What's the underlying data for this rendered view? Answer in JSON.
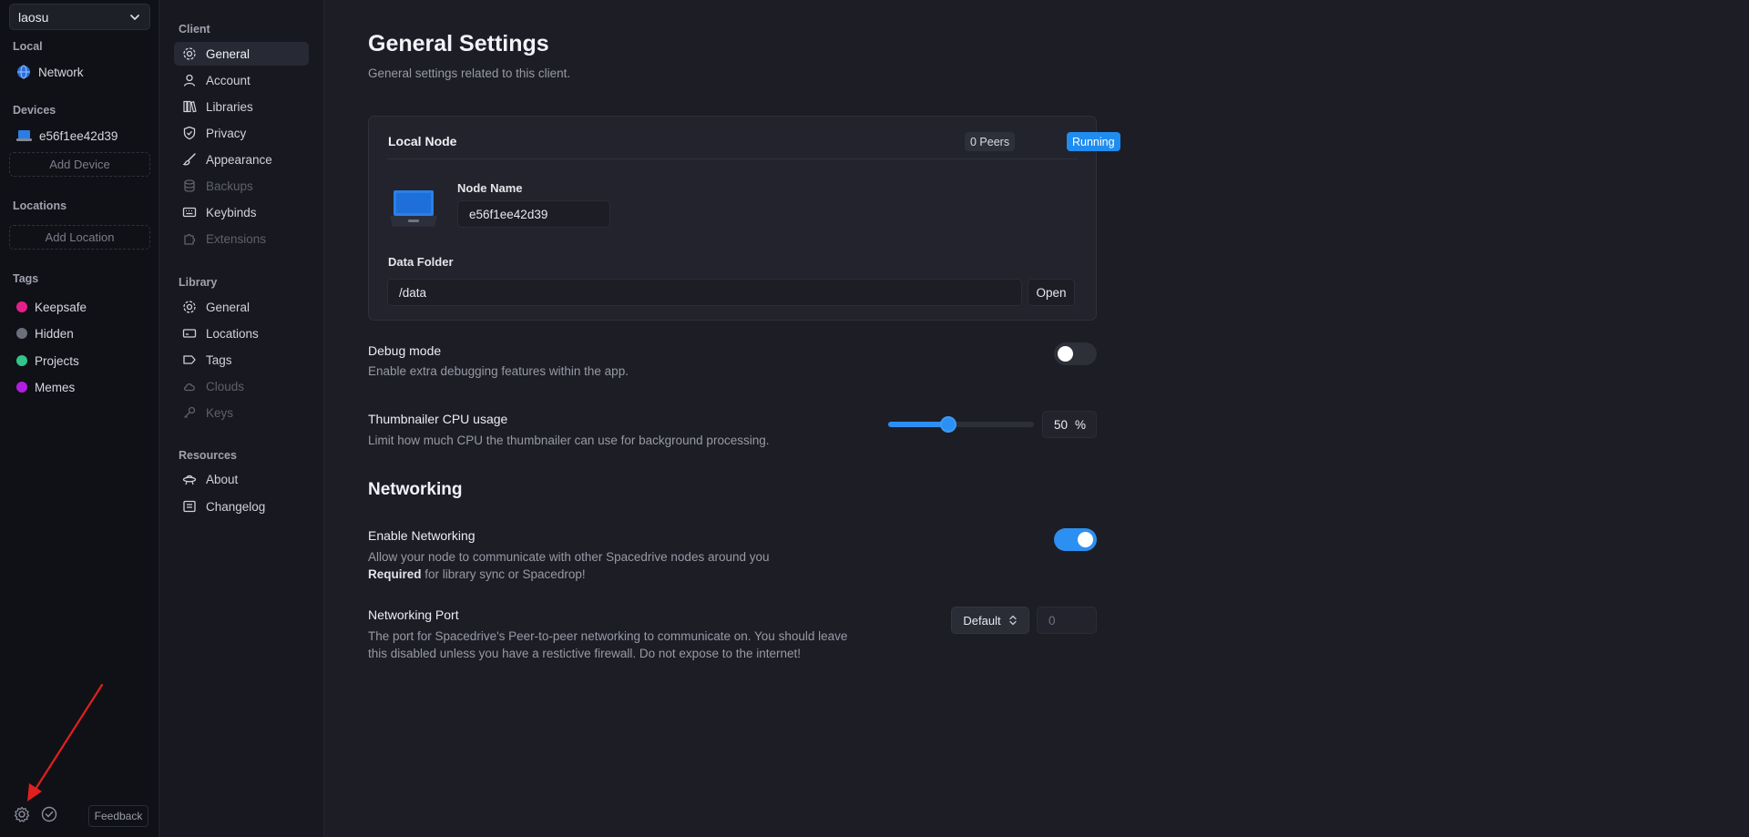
{
  "library_selector": {
    "value": "laosu"
  },
  "sidebar": {
    "local_heading": "Local",
    "local_items": [
      {
        "label": "Network",
        "icon": "globe-icon"
      }
    ],
    "devices_heading": "Devices",
    "devices": [
      {
        "label": "e56f1ee42d39",
        "icon": "laptop-icon"
      }
    ],
    "add_device": "Add Device",
    "locations_heading": "Locations",
    "add_location": "Add Location",
    "tags_heading": "Tags",
    "tags": [
      {
        "label": "Keepsafe",
        "color": "#e3208a"
      },
      {
        "label": "Hidden",
        "color": "#6b6f7c"
      },
      {
        "label": "Projects",
        "color": "#33c489"
      },
      {
        "label": "Memes",
        "color": "#b21ee0"
      }
    ],
    "feedback": "Feedback"
  },
  "settings_nav": {
    "client_heading": "Client",
    "client_items": [
      {
        "label": "General",
        "icon": "gear-icon",
        "active": true,
        "disabled": false
      },
      {
        "label": "Account",
        "icon": "user-icon",
        "active": false,
        "disabled": false
      },
      {
        "label": "Libraries",
        "icon": "books-icon",
        "active": false,
        "disabled": false
      },
      {
        "label": "Privacy",
        "icon": "shield-icon",
        "active": false,
        "disabled": false
      },
      {
        "label": "Appearance",
        "icon": "brush-icon",
        "active": false,
        "disabled": false
      },
      {
        "label": "Backups",
        "icon": "database-icon",
        "active": false,
        "disabled": true
      },
      {
        "label": "Keybinds",
        "icon": "keyboard-icon",
        "active": false,
        "disabled": false
      },
      {
        "label": "Extensions",
        "icon": "puzzle-icon",
        "active": false,
        "disabled": true
      }
    ],
    "library_heading": "Library",
    "library_items": [
      {
        "label": "General",
        "icon": "gear-icon",
        "disabled": false
      },
      {
        "label": "Locations",
        "icon": "drive-icon",
        "disabled": false
      },
      {
        "label": "Tags",
        "icon": "tag-icon",
        "disabled": false
      },
      {
        "label": "Clouds",
        "icon": "cloud-icon",
        "disabled": true
      },
      {
        "label": "Keys",
        "icon": "key-icon",
        "disabled": true
      }
    ],
    "resources_heading": "Resources",
    "resources_items": [
      {
        "label": "About",
        "icon": "ufo-icon",
        "disabled": false
      },
      {
        "label": "Changelog",
        "icon": "note-icon",
        "disabled": false
      }
    ]
  },
  "main": {
    "title": "General Settings",
    "subtitle": "General settings related to this client.",
    "local_node": {
      "title": "Local Node",
      "peers_badge": "0 Peers",
      "status_badge": "Running",
      "node_name_label": "Node Name",
      "node_name_value": "e56f1ee42d39",
      "data_folder_label": "Data Folder",
      "data_folder_value": "/data",
      "open_button": "Open"
    },
    "debug_mode": {
      "title": "Debug mode",
      "description": "Enable extra debugging features within the app.",
      "enabled": false
    },
    "thumbnailer": {
      "title": "Thumbnailer CPU usage",
      "description": "Limit how much CPU the thumbnailer can use for background processing.",
      "value": "50",
      "unit": "%",
      "fraction": 0.5
    },
    "networking_heading": "Networking",
    "enable_networking": {
      "title": "Enable Networking",
      "description_line1": "Allow your node to communicate with other Spacedrive nodes around you",
      "required_bold": "Required",
      "description_line2_rest": " for library sync or Spacedrop!",
      "enabled": true
    },
    "networking_port": {
      "title": "Networking Port",
      "description_line1": "The port for Spacedrive's Peer-to-peer networking to communicate on. You should leave",
      "description_line2": "this disabled unless you have a restictive firewall. Do not expose to the internet!",
      "select_value": "Default",
      "port_placeholder": "0"
    }
  },
  "colors": {
    "accent": "#2c8ff2",
    "annotation_arrow": "#e02020"
  }
}
